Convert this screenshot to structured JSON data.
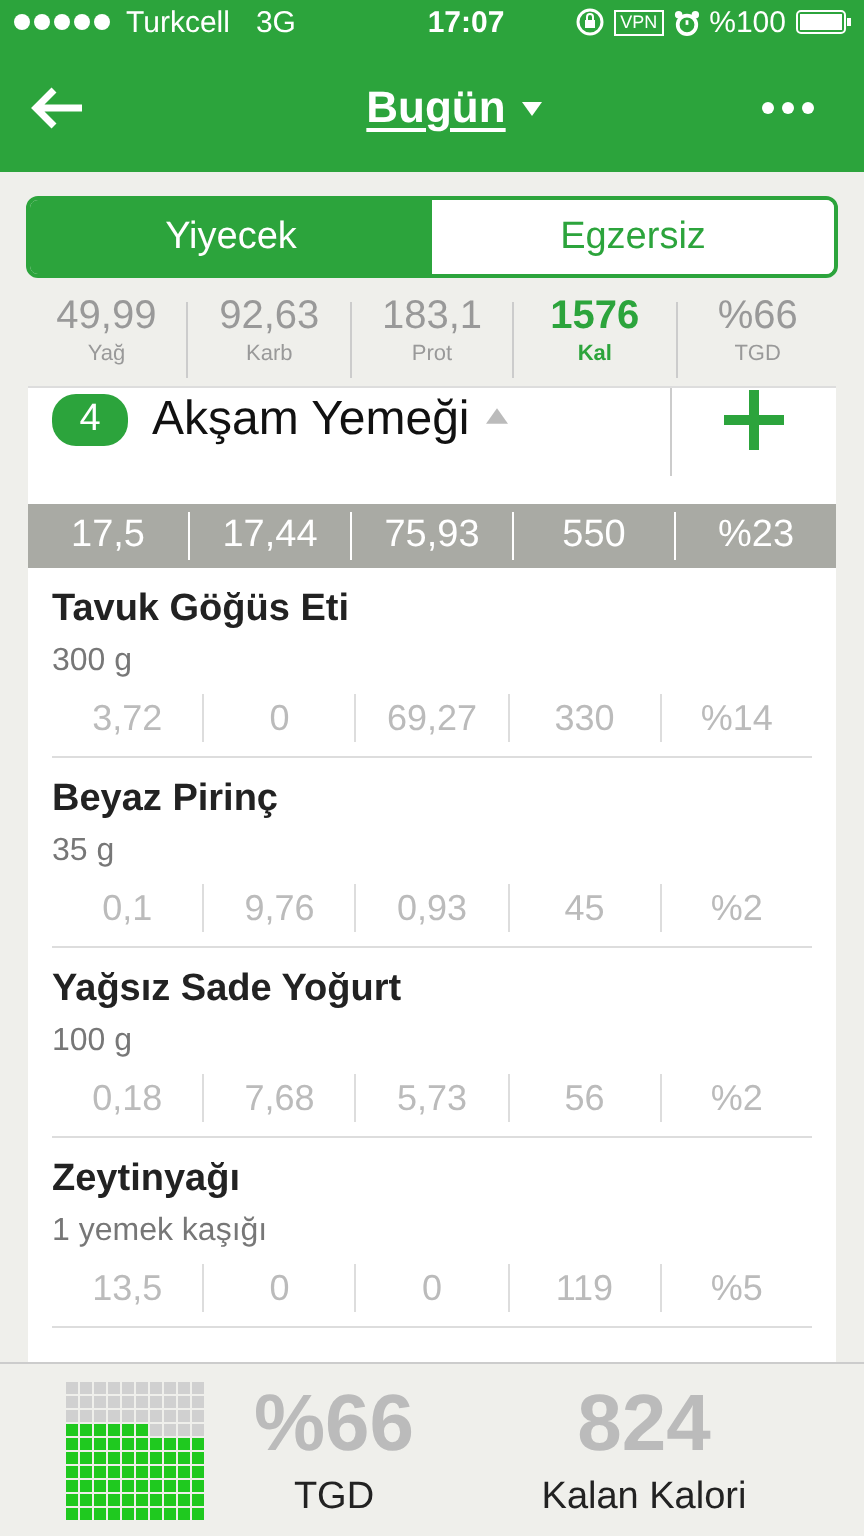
{
  "status_bar": {
    "carrier": "Turkcell",
    "network": "3G",
    "time": "17:07",
    "vpn": "VPN",
    "battery": "%100"
  },
  "nav": {
    "title": "Bugün"
  },
  "tabs": [
    {
      "label": "Yiyecek",
      "selected": true
    },
    {
      "label": "Egzersiz",
      "selected": false
    }
  ],
  "summary": [
    {
      "value": "49,99",
      "label": "Yağ",
      "highlight": false
    },
    {
      "value": "92,63",
      "label": "Karb",
      "highlight": false
    },
    {
      "value": "183,1",
      "label": "Prot",
      "highlight": false
    },
    {
      "value": "1576",
      "label": "Kal",
      "highlight": true
    },
    {
      "value": "%66",
      "label": "TGD",
      "highlight": false
    }
  ],
  "meal": {
    "number": "4",
    "title": "Akşam Yemeği",
    "totals": [
      "17,5",
      "17,44",
      "75,93",
      "550",
      "%23"
    ],
    "items": [
      {
        "name": "Tavuk Göğüs Eti",
        "amount": "300 g",
        "values": [
          "3,72",
          "0",
          "69,27",
          "330",
          "%14"
        ]
      },
      {
        "name": "Beyaz Pirinç",
        "amount": "35 g",
        "values": [
          "0,1",
          "9,76",
          "0,93",
          "45",
          "%2"
        ]
      },
      {
        "name": "Yağsız Sade Yoğurt",
        "amount": "100 g",
        "values": [
          "0,18",
          "7,68",
          "5,73",
          "56",
          "%2"
        ]
      },
      {
        "name": "Zeytinyağı",
        "amount": "1 yemek kaşığı",
        "values": [
          "13,5",
          "0",
          "0",
          "119",
          "%5"
        ]
      }
    ]
  },
  "footer": {
    "tgd_value": "%66",
    "tgd_label": "TGD",
    "remaining_value": "824",
    "remaining_label": "Kalan Kalori"
  }
}
